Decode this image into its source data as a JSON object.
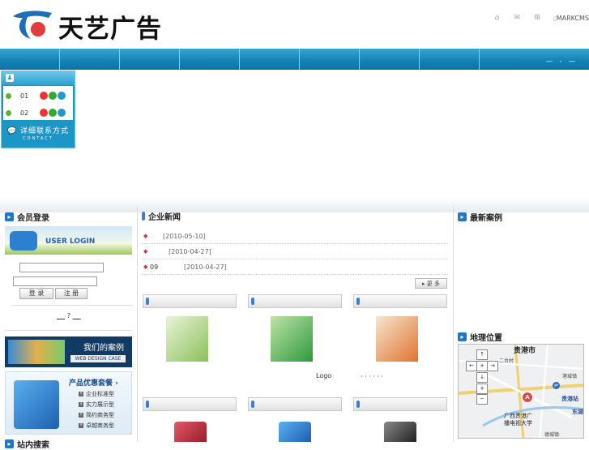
{
  "header": {
    "logo_text": "天艺广告",
    "brand": "MARKCMS",
    "top_icons": [
      "home-icon",
      "mail-icon",
      "sitemap-icon"
    ]
  },
  "nav": {
    "right_text": "— - —"
  },
  "qq_panel": {
    "rows": [
      {
        "num": "01"
      },
      {
        "num": "02"
      }
    ],
    "footer_cn": "详细联系方式",
    "footer_en": "CONTACT"
  },
  "left": {
    "title": "会员登录",
    "banner": "USER LOGIN",
    "login_button": "登 录",
    "register_button": "注 册",
    "help_mark": "?",
    "case_banner_title": "我们的案例",
    "case_banner_sub": "WEB DESIGN CASE",
    "package_title": "产品优惠套餐 ›",
    "package_items": [
      "企业标准型",
      "实力展示型",
      "简约商务型",
      "卓越商务型"
    ],
    "bottom_title": "站内搜索"
  },
  "middle": {
    "title": "企业新闻",
    "news": [
      {
        "prefix": "",
        "date": "[2010-05-10]"
      },
      {
        "prefix": "",
        "date": "[2010-04-27]"
      },
      {
        "prefix": "09",
        "date": "[2010-04-27]"
      }
    ],
    "more": "更 多",
    "logo_caption": "Logo",
    "dots": "·  ·   ·   ·   ·   ·"
  },
  "right": {
    "cases_title": "最新案例",
    "map_title": "地理位置",
    "map_labels": {
      "city": "贵港市",
      "village": "二台村",
      "station1": "港城镇",
      "station2": "贵港站",
      "east": "东湖",
      "school": "广西贵港广\n播电视大学",
      "marker": "A",
      "south": "德城镇"
    }
  },
  "colors": {
    "nav": "#1583b7",
    "accent": "#1f78c1",
    "marker": "#e24848"
  }
}
